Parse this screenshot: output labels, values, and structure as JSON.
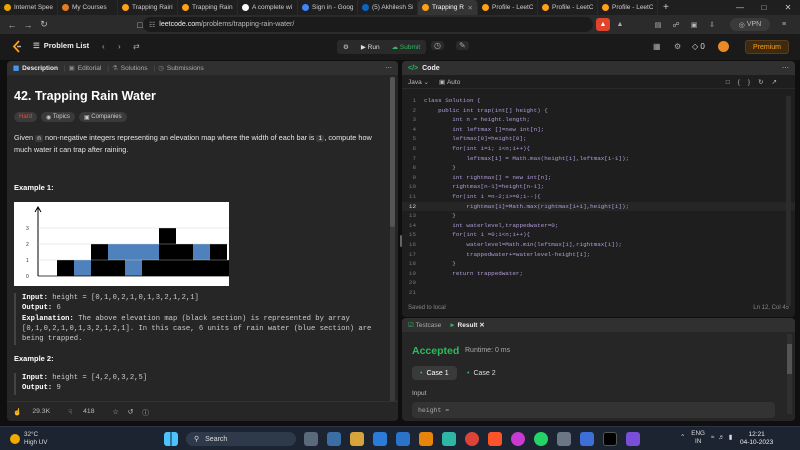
{
  "browser": {
    "tabs": [
      {
        "label": "Internet Speed",
        "color": "#f0a500"
      },
      {
        "label": "My Courses",
        "color": "#e57c20"
      },
      {
        "label": "Trapping Rain\\",
        "color": "#ffa116"
      },
      {
        "label": "Trapping Rain V",
        "color": "#ffa116"
      },
      {
        "label": "A complete wi",
        "color": "#ffffff"
      },
      {
        "label": "Sign in - Goog",
        "color": "#4285f4"
      },
      {
        "label": "(5) Akhilesh Sin",
        "color": "#0a66c2"
      },
      {
        "label": "Trapping R",
        "color": "#ffa116"
      },
      {
        "label": "Profile - LeetCo",
        "color": "#ffa116"
      },
      {
        "label": "Profile - LeetCo",
        "color": "#ffa116"
      },
      {
        "label": "Profile - LeetCo",
        "color": "#ffa116"
      }
    ],
    "new_tab": "+",
    "url_domain": "leetcode.com",
    "url_path": "/problems/trapping-rain-water/",
    "vpn_label": "VPN"
  },
  "header": {
    "problem_list": "Problem List",
    "run": "Run",
    "submit": "Submit",
    "streak": "0",
    "premium": "Premium"
  },
  "description": {
    "tabs": [
      "Description",
      "Editorial",
      "Solutions",
      "Submissions"
    ],
    "title": "42. Trapping Rain Water",
    "difficulty": "Hard",
    "topics": "Topics",
    "companies": "Companies",
    "text_before": "Given ",
    "code_n": "n",
    "text_middle": " non-negative integers representing an elevation map where the width of each bar is ",
    "code_1": "1",
    "text_after": ", compute how much water it can trap after raining.",
    "example1_title": "Example 1:",
    "example1_input_label": "Input:",
    "example1_input": " height = [0,1,0,2,1,0,1,3,2,1,2,1]",
    "example1_output_label": "Output:",
    "example1_output": " 6",
    "example1_expl_label": "Explanation:",
    "example1_expl": " The above elevation map (black section) is represented by array [0,1,0,2,1,0,1,3,2,1,2,1]. In this case, 6 units of rain water (blue section) are being trapped.",
    "example2_title": "Example 2:",
    "example2_input_label": "Input:",
    "example2_input": " height = [4,2,0,3,2,5]",
    "example2_output_label": "Output:",
    "example2_output": " 9",
    "likes": "29.3K",
    "dislikes": "418"
  },
  "figure": {
    "y_ticks": [
      "0",
      "1",
      "2",
      "3"
    ],
    "heights": [
      0,
      1,
      0,
      2,
      1,
      0,
      1,
      3,
      2,
      1,
      2,
      1
    ],
    "water": [
      0,
      0,
      1,
      0,
      1,
      2,
      1,
      0,
      0,
      1,
      0,
      0
    ],
    "bar_color": "#000000",
    "water_color": "#4f81bd"
  },
  "editor": {
    "title": "Code",
    "language": "Java",
    "mode": "Auto",
    "lines": [
      "class Solution {",
      "    public int trap(int[] height) {",
      "        int n = height.length;",
      "        int leftmax []=new int[n];",
      "        leftmax[0]=height[0];",
      "        for(int i=1; i<n;i++){",
      "            leftmax[i] = Math.max(height[i],leftmax[i-1]);",
      "        }",
      "        int rightmax[] = new int[n];",
      "        rightmax[n-1]=height[n-1];",
      "        for(int i =n-2;i>=0;i--){",
      "            rightmax[i]=Math.max(rightmax[i+1],height[i]);",
      "        }",
      "        int waterlevel,trappedwater=0;",
      "        for(int i =0;i<n;i++){",
      "            waterlevel=Math.min(leftmax[i],rightmax[i]);",
      "            trappedwater+=waterlevel-height[i];",
      "        }",
      "        return trappedwater;",
      "",
      ""
    ],
    "current_line": 12,
    "saved": "Saved to local",
    "cursor": "Ln 12, Col 45"
  },
  "result": {
    "tab_testcase": "Testcase",
    "tab_result": "Result",
    "status": "Accepted",
    "runtime": "Runtime: 0 ms",
    "case1": "Case 1",
    "case2": "Case 2",
    "input_label": "Input",
    "input_value": "height ="
  },
  "taskbar": {
    "temp": "32°C",
    "weather": "High UV",
    "search": "Search",
    "lang1": "ENG",
    "lang2": "IN",
    "time": "12:21",
    "date": "04-10-2023"
  }
}
